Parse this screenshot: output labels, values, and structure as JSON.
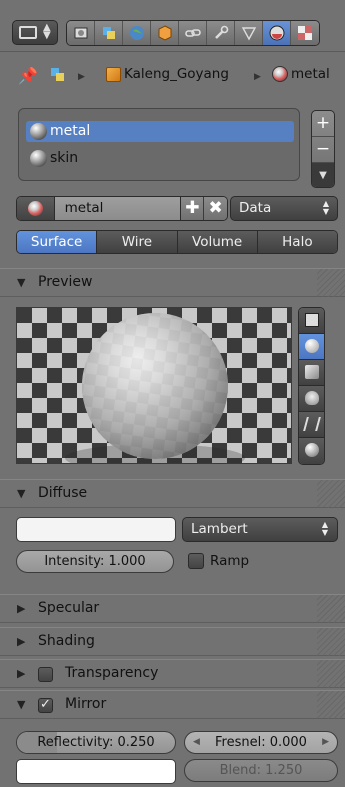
{
  "header": {
    "editor_type_icon": "properties-editor-icon",
    "context_tabs": [
      {
        "icon": "render-icon",
        "active": false
      },
      {
        "icon": "render-layers-icon",
        "active": false
      },
      {
        "icon": "world-icon",
        "active": false
      },
      {
        "icon": "object-icon",
        "active": false
      },
      {
        "icon": "constraints-icon",
        "active": false
      },
      {
        "icon": "modifiers-icon",
        "active": false
      },
      {
        "icon": "mesh-data-icon",
        "active": false
      },
      {
        "icon": "material-icon",
        "active": true
      },
      {
        "icon": "texture-icon",
        "active": false
      }
    ]
  },
  "breadcrumb": {
    "pin_icon": "pin-icon",
    "object_name": "Kaleng_Goyang",
    "material_name": "metal"
  },
  "material_slots": {
    "items": [
      {
        "label": "metal",
        "selected": true
      },
      {
        "label": "skin",
        "selected": false
      }
    ],
    "add_label": "+",
    "remove_label": "−",
    "menu_label": "▼"
  },
  "datablock": {
    "name": "metal",
    "add_label": "✚",
    "unlink_label": "✖",
    "link_value": "Data"
  },
  "tabs": [
    {
      "label": "Surface",
      "active": true
    },
    {
      "label": "Wire",
      "active": false
    },
    {
      "label": "Volume",
      "active": false
    },
    {
      "label": "Halo",
      "active": false
    }
  ],
  "panels": {
    "preview": {
      "title": "Preview",
      "expanded": true
    },
    "diffuse": {
      "title": "Diffuse",
      "expanded": true
    },
    "specular": {
      "title": "Specular",
      "expanded": false
    },
    "shading": {
      "title": "Shading",
      "expanded": false
    },
    "transparency": {
      "title": "Transparency",
      "expanded": false,
      "enabled": false
    },
    "mirror": {
      "title": "Mirror",
      "expanded": true,
      "enabled": true
    }
  },
  "preview_shapes": [
    "plane",
    "sphere",
    "cube",
    "monkey",
    "hair",
    "sphere-sky"
  ],
  "diffuse": {
    "color": "#f4f4f4",
    "shader": "Lambert",
    "intensity_label": "Intensity: 1.000",
    "ramp_label": "Ramp",
    "ramp_enabled": false
  },
  "mirror": {
    "reflectivity_label": "Reflectivity: 0.250",
    "reflectivity": 0.25,
    "fresnel_label": "Fresnel: 0.000",
    "blend_label": "Blend: 1.250",
    "color": "#ffffff"
  },
  "colors": {
    "panel_bg": "#727272",
    "accent": "#5680c2"
  }
}
